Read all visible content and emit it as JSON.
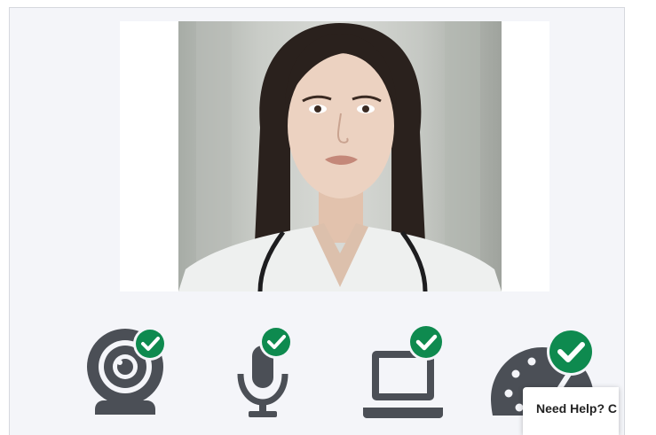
{
  "camera_preview": {
    "subject": "camera-feed"
  },
  "device_checks": [
    {
      "device": "webcam",
      "icon": "webcam-icon",
      "status": "passed"
    },
    {
      "device": "microphone",
      "icon": "microphone-icon",
      "status": "passed"
    },
    {
      "device": "computer",
      "icon": "laptop-icon",
      "status": "passed"
    },
    {
      "device": "connection-speed",
      "icon": "speedometer-icon",
      "status": "passed"
    }
  ],
  "colors": {
    "panel_bg": "#f4f5f9",
    "icon_gray": "#4b4f56",
    "check_green": "#0e8a4f",
    "check_mark": "#ffffff"
  },
  "help": {
    "label": "Need Help? C"
  }
}
